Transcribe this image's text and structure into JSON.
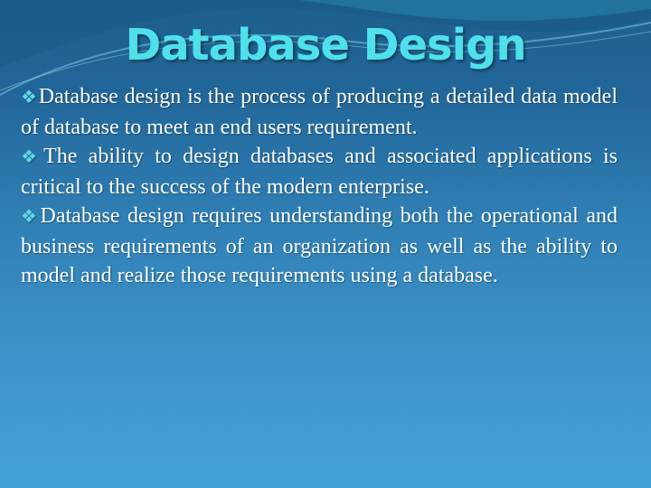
{
  "slide": {
    "title": "Database Design",
    "bullet_icon": "❖",
    "paragraphs": [
      {
        "text": "Database design is the process of producing a detailed data model of database to meet an end users requirement."
      },
      {
        "text": "The ability to design databases and associated applications is critical to the success of the modern enterprise."
      },
      {
        "text": "Database design requires understanding both the operational and business requirements of an organization as well as the ability to model and realize those requirements using a database."
      }
    ]
  },
  "colors": {
    "title": "#4fe0ee",
    "bullet": "#5fd9e6",
    "text": "#ffffff",
    "background_top": "#1d5f8c",
    "background_bottom": "#45a2d8"
  }
}
